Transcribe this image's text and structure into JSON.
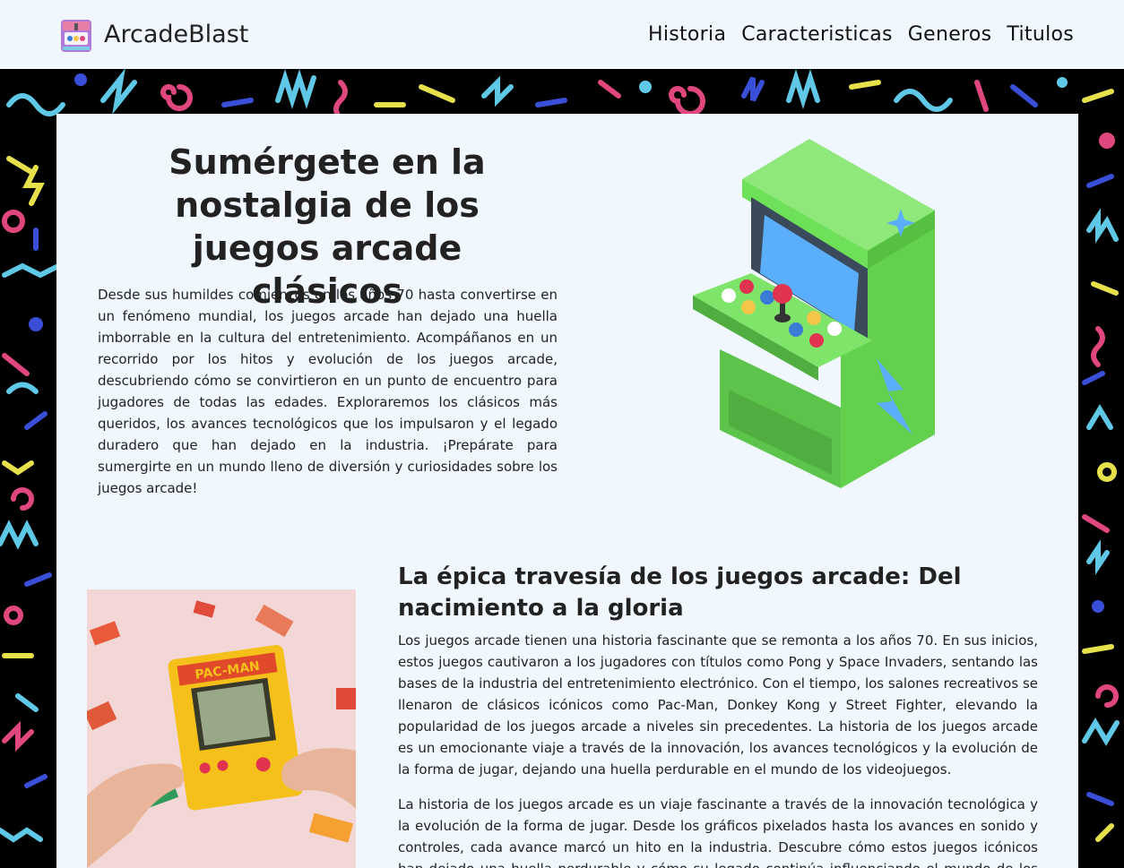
{
  "navbar": {
    "brand": "ArcadeBlast",
    "links": [
      "Historia",
      "Caracteristicas",
      "Generos",
      "Titulos"
    ]
  },
  "hero": {
    "title": "Sumérgete en la nostalgia de los juegos arcade clásicos",
    "text": "Desde sus humildes comienzos en los años 70 hasta convertirse en un fenómeno mundial, los juegos arcade han dejado una huella imborrable en la cultura del entretenimiento. Acompáñanos en un recorrido por los hitos y evolución de los juegos arcade, descubriendo cómo se convirtieron en un punto de encuentro para jugadores de todas las edades. Exploraremos los clásicos más queridos, los avances tecnológicos que los impulsaron y el legado duradero que han dejado en la industria. ¡Prepárate para sumergirte en un mundo lleno de diversión y curiosidades sobre los juegos arcade!"
  },
  "history": {
    "title": "La épica travesía de los juegos arcade: Del nacimiento a la gloria",
    "p1": "Los juegos arcade tienen una historia fascinante que se remonta a los años 70. En sus inicios, estos juegos cautivaron a los jugadores con títulos como Pong y Space Invaders, sentando las bases de la industria del entretenimiento electrónico. Con el tiempo, los salones recreativos se llenaron de clásicos icónicos como Pac-Man, Donkey Kong y Street Fighter, elevando la popularidad de los juegos arcade a niveles sin precedentes. La historia de los juegos arcade es un emocionante viaje a través de la innovación, los avances tecnológicos y la evolución de la forma de jugar, dejando una huella perdurable en el mundo de los videojuegos.",
    "p2": "La historia de los juegos arcade es un viaje fascinante a través de la innovación tecnológica y la evolución de la forma de jugar. Desde los gráficos pixelados hasta los avances en sonido y controles, cada avance marcó un hito en la industria. Descubre cómo estos juegos icónicos han dejado una huella perdurable y cómo su legado continúa influenciando el mundo de los videojuegos.",
    "photo_label": "PAC-MAN"
  },
  "colors": {
    "panel_bg": "#f0f7fe",
    "arcade_green": "#6ee05a",
    "pattern_pink": "#e0477e",
    "pattern_cyan": "#5ec8e6",
    "pattern_yellow": "#e6e04a",
    "pattern_blue": "#3a4fd8"
  }
}
